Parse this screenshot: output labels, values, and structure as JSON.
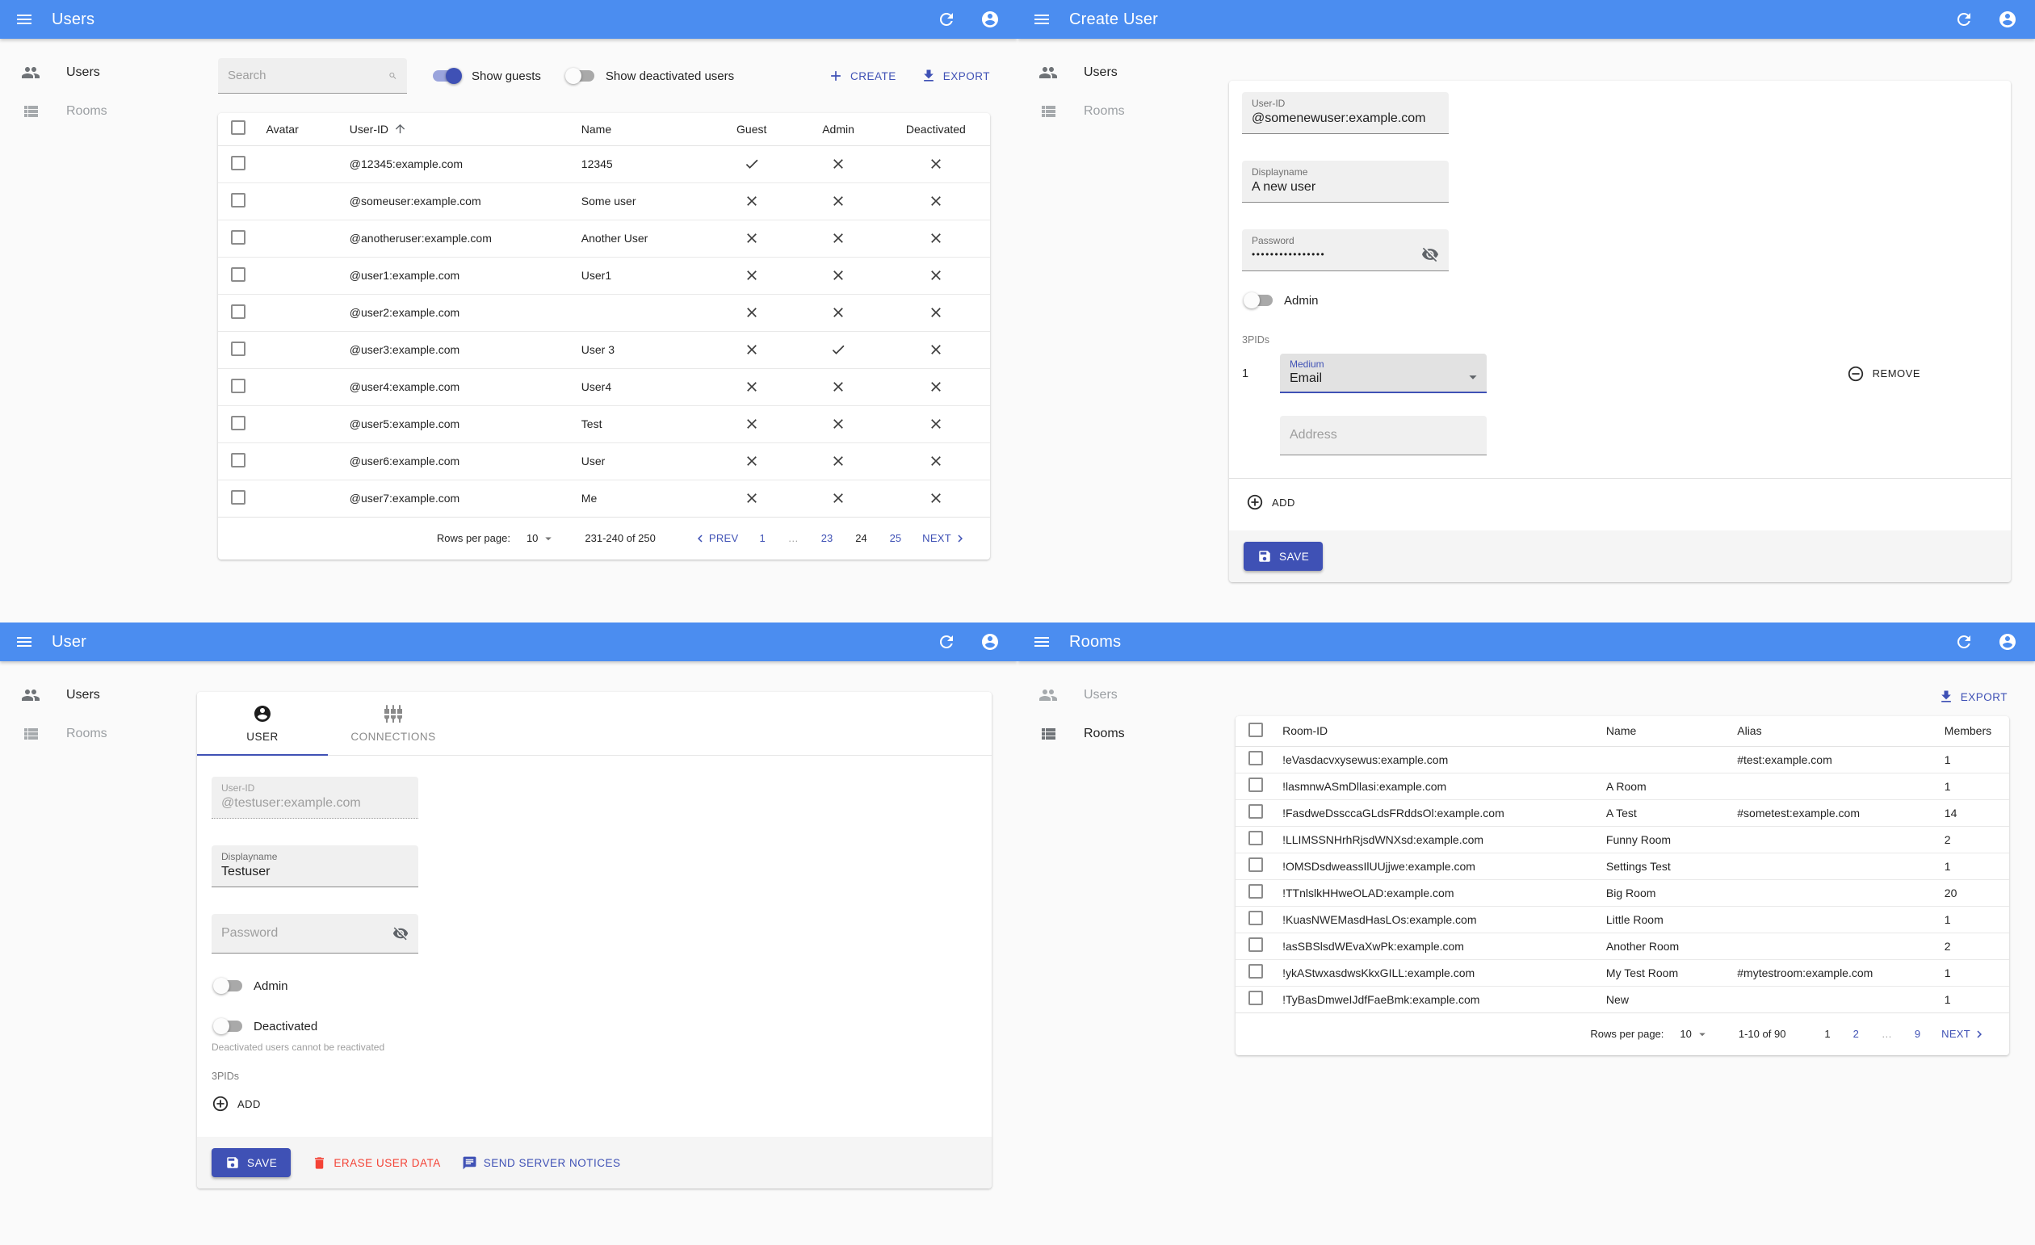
{
  "theme": {
    "appbar_blue": "#4b8df0",
    "accent_indigo": "#3f51b5",
    "danger_red": "#f44336"
  },
  "panels": {
    "users_list": {
      "appbar_title": "Users",
      "sidebar": {
        "users": "Users",
        "rooms": "Rooms"
      },
      "toolbar": {
        "search_placeholder": "Search",
        "show_guests_label": "Show guests",
        "show_guests_on": true,
        "show_deactivated_label": "Show deactivated users",
        "show_deactivated_on": false,
        "create_label": "CREATE",
        "export_label": "EXPORT"
      },
      "table": {
        "headers": {
          "avatar": "Avatar",
          "user_id": "User-ID",
          "name": "Name",
          "guest": "Guest",
          "admin": "Admin",
          "deactivated": "Deactivated"
        },
        "rows": [
          {
            "user_id": "@12345:example.com",
            "name": "12345",
            "guest": true,
            "admin": false,
            "deactivated": false
          },
          {
            "user_id": "@someuser:example.com",
            "name": "Some user",
            "guest": false,
            "admin": false,
            "deactivated": false
          },
          {
            "user_id": "@anotheruser:example.com",
            "name": "Another User",
            "guest": false,
            "admin": false,
            "deactivated": false
          },
          {
            "user_id": "@user1:example.com",
            "name": "User1",
            "guest": false,
            "admin": false,
            "deactivated": false
          },
          {
            "user_id": "@user2:example.com",
            "name": "",
            "guest": false,
            "admin": false,
            "deactivated": false
          },
          {
            "user_id": "@user3:example.com",
            "name": "User 3",
            "guest": false,
            "admin": true,
            "deactivated": false
          },
          {
            "user_id": "@user4:example.com",
            "name": "User4",
            "guest": false,
            "admin": false,
            "deactivated": false
          },
          {
            "user_id": "@user5:example.com",
            "name": "Test",
            "guest": false,
            "admin": false,
            "deactivated": false
          },
          {
            "user_id": "@user6:example.com",
            "name": "User",
            "guest": false,
            "admin": false,
            "deactivated": false
          },
          {
            "user_id": "@user7:example.com",
            "name": "Me",
            "guest": false,
            "admin": false,
            "deactivated": false
          }
        ]
      },
      "pagination": {
        "rows_per_page_label": "Rows per page:",
        "rows_per_page": "10",
        "range": "231-240 of 250",
        "prev_label": "PREV",
        "next_label": "NEXT",
        "pages": [
          {
            "label": "1",
            "state": "link"
          },
          {
            "label": "…",
            "state": "gap"
          },
          {
            "label": "23",
            "state": "link"
          },
          {
            "label": "24",
            "state": "current"
          },
          {
            "label": "25",
            "state": "link"
          }
        ]
      }
    },
    "create_user": {
      "appbar_title": "Create User",
      "sidebar": {
        "users": "Users",
        "rooms": "Rooms"
      },
      "form": {
        "user_id": {
          "label": "User-ID",
          "value": "@somenewuser:example.com"
        },
        "displayname": {
          "label": "Displayname",
          "value": "A new user"
        },
        "password": {
          "label": "Password",
          "value": "••••••••••••••••"
        },
        "admin_label": "Admin",
        "admin_on": false,
        "threepids_label": "3PIDs",
        "pid_index": "1",
        "medium": {
          "label": "Medium",
          "value": "Email"
        },
        "remove_label": "REMOVE",
        "address_placeholder": "Address",
        "add_label": "ADD",
        "save_label": "SAVE"
      }
    },
    "user_detail": {
      "appbar_title": "User",
      "sidebar": {
        "users": "Users",
        "rooms": "Rooms"
      },
      "tabs": {
        "user": "USER",
        "connections": "CONNECTIONS"
      },
      "form": {
        "user_id": {
          "label": "User-ID",
          "value": "@testuser:example.com"
        },
        "displayname": {
          "label": "Displayname",
          "value": "Testuser"
        },
        "password_placeholder": "Password",
        "admin_label": "Admin",
        "admin_on": false,
        "deactivated_label": "Deactivated",
        "deactivated_on": false,
        "deactivated_helper": "Deactivated users cannot be reactivated",
        "threepids_label": "3PIDs",
        "add_label": "ADD",
        "save_label": "SAVE",
        "erase_label": "ERASE USER DATA",
        "notices_label": "SEND SERVER NOTICES"
      }
    },
    "rooms_list": {
      "appbar_title": "Rooms",
      "sidebar": {
        "users": "Users",
        "rooms": "Rooms"
      },
      "export_label": "EXPORT",
      "table": {
        "headers": {
          "room_id": "Room-ID",
          "name": "Name",
          "alias": "Alias",
          "members": "Members"
        },
        "rows": [
          {
            "room_id": "!eVasdacvxysewus:example.com",
            "name": "",
            "alias": "#test:example.com",
            "members": "1"
          },
          {
            "room_id": "!lasmnwASmDllasi:example.com",
            "name": "A Room",
            "alias": "",
            "members": "1"
          },
          {
            "room_id": "!FasdweDssccaGLdsFRddsOl:example.com",
            "name": "A Test",
            "alias": "#sometest:example.com",
            "members": "14"
          },
          {
            "room_id": "!LLIMSSNHrhRjsdWNXsd:example.com",
            "name": "Funny Room",
            "alias": "",
            "members": "2"
          },
          {
            "room_id": "!OMSDsdweassIlUUjjwe:example.com",
            "name": "Settings Test",
            "alias": "",
            "members": "1"
          },
          {
            "room_id": "!TTnlslkHHweOLAD:example.com",
            "name": "Big Room",
            "alias": "",
            "members": "20"
          },
          {
            "room_id": "!KuasNWEMasdHasLOs:example.com",
            "name": "Little Room",
            "alias": "",
            "members": "1"
          },
          {
            "room_id": "!asSBSlsdWEvaXwPk:example.com",
            "name": "Another Room",
            "alias": "",
            "members": "2"
          },
          {
            "room_id": "!ykAStwxasdwsKkxGILL:example.com",
            "name": "My Test Room",
            "alias": "#mytestroom:example.com",
            "members": "1"
          },
          {
            "room_id": "!TyBasDmweIJdfFaeBmk:example.com",
            "name": "New",
            "alias": "",
            "members": "1"
          }
        ]
      },
      "pagination": {
        "rows_per_page_label": "Rows per page:",
        "rows_per_page": "10",
        "range": "1-10 of 90",
        "next_label": "NEXT",
        "pages": [
          {
            "label": "1",
            "state": "current"
          },
          {
            "label": "2",
            "state": "link"
          },
          {
            "label": "…",
            "state": "gap"
          },
          {
            "label": "9",
            "state": "link"
          }
        ]
      }
    }
  }
}
